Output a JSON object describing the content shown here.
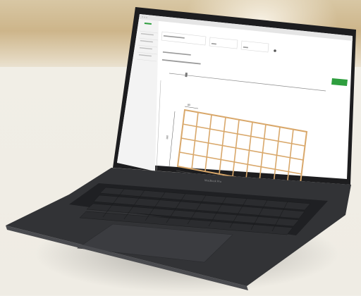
{
  "browser": {
    "url": "…"
  },
  "app": {
    "logo": "…",
    "sidebar_items": [
      "…",
      "…",
      "…",
      "…",
      "…"
    ],
    "fields": [
      {
        "label": "Ausrichtung",
        "value": "Hochformat / Querformat"
      },
      {
        "label": "Plattenlänge",
        "value": "2,8"
      },
      {
        "label": "Plattenbreite",
        "value": "2,8"
      }
    ],
    "subtitle": "Konstrukt. Aufbauschematik",
    "section_title": "Schematische Darstellung der Latte",
    "button_label": "Speichern",
    "drawing": {
      "dim_top": "80",
      "dim_left": "160",
      "dim_bottom": "800",
      "dim_right": "80"
    }
  },
  "laptop": {
    "brand_text": "MacBook Pro"
  },
  "colors": {
    "accent_green": "#2e9e3e",
    "wood": "#d9a86b",
    "laptop_body": "#2f3033",
    "background": "#f2efe8"
  }
}
